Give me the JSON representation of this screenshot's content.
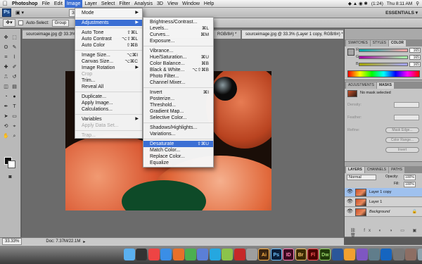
{
  "menubar": {
    "items": [
      "Photoshop",
      "File",
      "Edit",
      "Image",
      "Layer",
      "Select",
      "Filter",
      "Analysis",
      "3D",
      "View",
      "Window",
      "Help"
    ],
    "battery": "(1:24)",
    "clock": "Thu 8:11 AM",
    "active_index": 3
  },
  "appbar": {
    "zoom": "33.3%",
    "workspace": "ESSENTIALS ▾"
  },
  "options": {
    "auto_select_label": "Auto-Select:",
    "auto_select_value": "Group"
  },
  "tabs": [
    {
      "label": "sourceimage.jpg @ 33.3% (Layer 1, RGB/8#)"
    },
    {
      "label": "RGB/8#) *"
    },
    {
      "label": "sourceimage.jpg @ 33.3% (Layer 1 copy, RGB/8#) *"
    }
  ],
  "status": {
    "zoom": "33.33%",
    "doc": "Doc: 7.37M/22.1M"
  },
  "image_menu": {
    "items": [
      {
        "label": "Mode",
        "shortcut": "",
        "submenu": true,
        "disabled": false,
        "highlight": false
      },
      {
        "sep": true
      },
      {
        "label": "Adjustments",
        "shortcut": "",
        "submenu": true,
        "disabled": false,
        "highlight": true
      },
      {
        "sep": true
      },
      {
        "label": "Auto Tone",
        "shortcut": "⇧⌘L",
        "submenu": false,
        "disabled": false,
        "highlight": false
      },
      {
        "label": "Auto Contrast",
        "shortcut": "⌥⇧⌘L",
        "submenu": false,
        "disabled": false,
        "highlight": false
      },
      {
        "label": "Auto Color",
        "shortcut": "⇧⌘B",
        "submenu": false,
        "disabled": false,
        "highlight": false
      },
      {
        "sep": true
      },
      {
        "label": "Image Size...",
        "shortcut": "⌥⌘I",
        "submenu": false,
        "disabled": false,
        "highlight": false
      },
      {
        "label": "Canvas Size...",
        "shortcut": "⌥⌘C",
        "submenu": false,
        "disabled": false,
        "highlight": false
      },
      {
        "label": "Image Rotation",
        "shortcut": "",
        "submenu": true,
        "disabled": false,
        "highlight": false
      },
      {
        "label": "Crop",
        "shortcut": "",
        "submenu": false,
        "disabled": true,
        "highlight": false
      },
      {
        "label": "Trim...",
        "shortcut": "",
        "submenu": false,
        "disabled": false,
        "highlight": false
      },
      {
        "label": "Reveal All",
        "shortcut": "",
        "submenu": false,
        "disabled": false,
        "highlight": false
      },
      {
        "sep": true
      },
      {
        "label": "Duplicate...",
        "shortcut": "",
        "submenu": false,
        "disabled": false,
        "highlight": false
      },
      {
        "label": "Apply Image...",
        "shortcut": "",
        "submenu": false,
        "disabled": false,
        "highlight": false
      },
      {
        "label": "Calculations...",
        "shortcut": "",
        "submenu": false,
        "disabled": false,
        "highlight": false
      },
      {
        "sep": true
      },
      {
        "label": "Variables",
        "shortcut": "",
        "submenu": true,
        "disabled": false,
        "highlight": false
      },
      {
        "label": "Apply Data Set...",
        "shortcut": "",
        "submenu": false,
        "disabled": true,
        "highlight": false
      },
      {
        "sep": true
      },
      {
        "label": "Trap...",
        "shortcut": "",
        "submenu": false,
        "disabled": true,
        "highlight": false
      }
    ]
  },
  "adjust_menu": {
    "items": [
      {
        "label": "Brightness/Contrast...",
        "shortcut": "",
        "highlight": false
      },
      {
        "label": "Levels...",
        "shortcut": "⌘L",
        "highlight": false
      },
      {
        "label": "Curves...",
        "shortcut": "⌘M",
        "highlight": false
      },
      {
        "label": "Exposure...",
        "shortcut": "",
        "highlight": false
      },
      {
        "sep": true
      },
      {
        "label": "Vibrance...",
        "shortcut": "",
        "highlight": false
      },
      {
        "label": "Hue/Saturation...",
        "shortcut": "⌘U",
        "highlight": false
      },
      {
        "label": "Color Balance...",
        "shortcut": "⌘B",
        "highlight": false
      },
      {
        "label": "Black & White...",
        "shortcut": "⌥⇧⌘B",
        "highlight": false
      },
      {
        "label": "Photo Filter...",
        "shortcut": "",
        "highlight": false
      },
      {
        "label": "Channel Mixer...",
        "shortcut": "",
        "highlight": false
      },
      {
        "sep": true
      },
      {
        "label": "Invert",
        "shortcut": "⌘I",
        "highlight": false
      },
      {
        "label": "Posterize...",
        "shortcut": "",
        "highlight": false
      },
      {
        "label": "Threshold...",
        "shortcut": "",
        "highlight": false
      },
      {
        "label": "Gradient Map...",
        "shortcut": "",
        "highlight": false
      },
      {
        "label": "Selective Color...",
        "shortcut": "",
        "highlight": false
      },
      {
        "sep": true
      },
      {
        "label": "Shadows/Highlights...",
        "shortcut": "",
        "highlight": false
      },
      {
        "label": "Variations...",
        "shortcut": "",
        "highlight": false
      },
      {
        "sep": true
      },
      {
        "label": "Desaturate",
        "shortcut": "⇧⌘U",
        "highlight": true
      },
      {
        "label": "Match Color...",
        "shortcut": "",
        "highlight": false
      },
      {
        "label": "Replace Color...",
        "shortcut": "",
        "highlight": false
      },
      {
        "label": "Equalize",
        "shortcut": "",
        "highlight": false
      }
    ]
  },
  "panels": {
    "color_tabs": [
      "SWATCHES",
      "STYLES",
      "COLOR"
    ],
    "color_values": {
      "r": "165",
      "g": "165",
      "b": "165"
    },
    "color_labels": {
      "r": "R",
      "g": "G",
      "b": "B"
    },
    "mask_tabs": [
      "ADJUSTMENTS",
      "MASKS"
    ],
    "mask_status": "No mask selected",
    "mask_fields": {
      "density": "Density:",
      "feather": "Feather:",
      "refine": "Refine:"
    },
    "mask_buttons": [
      "Mask Edge...",
      "Color Range...",
      "Invert"
    ],
    "layer_tabs": [
      "LAYERS",
      "CHANNELS",
      "PATHS"
    ],
    "blend_mode": "Normal",
    "opacity_label": "Opacity:",
    "opacity": "100%",
    "fill_label": "Fill:",
    "fill": "100%",
    "layers": [
      {
        "name": "Layer 1 copy",
        "selected": true
      },
      {
        "name": "Layer 1",
        "selected": false
      },
      {
        "name": "Background",
        "selected": false
      }
    ]
  },
  "dock": {
    "icons": [
      "finder-icon",
      "dashboard-icon",
      "ical-icon",
      "safari-icon",
      "firefox-icon",
      "chrome-icon",
      "itunes-icon",
      "skype-icon",
      "ichat-icon",
      "acrobat-icon",
      "preview-icon",
      "illustrator-icon",
      "photoshop-icon",
      "indesign-icon",
      "bridge-icon",
      "flash-icon",
      "dreamweaver-icon",
      "word-icon",
      "photo-icon",
      "itunes2-icon",
      "network-icon",
      "quicktime-icon",
      "system-prefs-icon",
      "downloads-icon",
      "documents-icon",
      "trash-icon"
    ],
    "labels": {
      "illustrator": "Ai",
      "photoshop": "Ps",
      "indesign": "ID",
      "bridge": "Br",
      "flash": "Fl",
      "dreamweaver": "Dw"
    }
  }
}
